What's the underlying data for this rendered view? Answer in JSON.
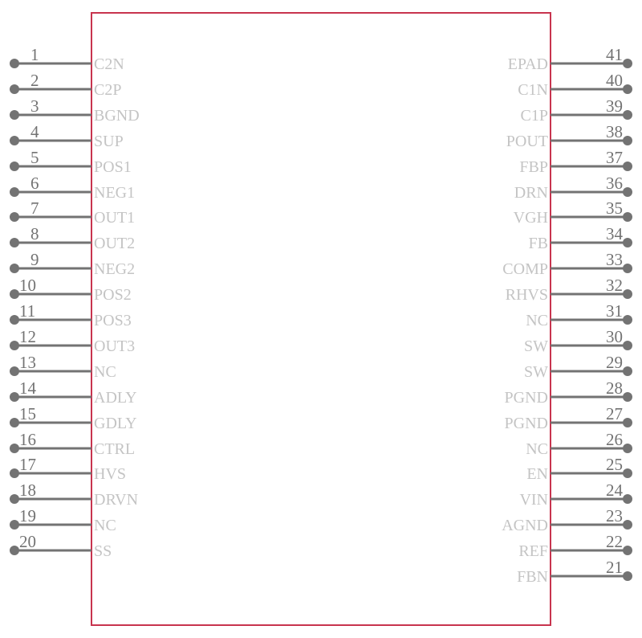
{
  "symbol": {
    "colors": {
      "body_outline": "#c8344e",
      "pin": "#737373",
      "pin_name": "#c4c4c4"
    },
    "left_pins": [
      {
        "number": "1",
        "name": "C2N"
      },
      {
        "number": "2",
        "name": "C2P"
      },
      {
        "number": "3",
        "name": "BGND"
      },
      {
        "number": "4",
        "name": "SUP"
      },
      {
        "number": "5",
        "name": "POS1"
      },
      {
        "number": "6",
        "name": "NEG1"
      },
      {
        "number": "7",
        "name": "OUT1"
      },
      {
        "number": "8",
        "name": "OUT2"
      },
      {
        "number": "9",
        "name": "NEG2"
      },
      {
        "number": "10",
        "name": "POS2"
      },
      {
        "number": "11",
        "name": "POS3"
      },
      {
        "number": "12",
        "name": "OUT3"
      },
      {
        "number": "13",
        "name": "NC"
      },
      {
        "number": "14",
        "name": "ADLY"
      },
      {
        "number": "15",
        "name": "GDLY"
      },
      {
        "number": "16",
        "name": "CTRL"
      },
      {
        "number": "17",
        "name": "HVS"
      },
      {
        "number": "18",
        "name": "DRVN"
      },
      {
        "number": "19",
        "name": "NC"
      },
      {
        "number": "20",
        "name": "SS"
      }
    ],
    "right_pins": [
      {
        "number": "41",
        "name": "EPAD"
      },
      {
        "number": "40",
        "name": "C1N"
      },
      {
        "number": "39",
        "name": "C1P"
      },
      {
        "number": "38",
        "name": "POUT"
      },
      {
        "number": "37",
        "name": "FBP"
      },
      {
        "number": "36",
        "name": "DRN"
      },
      {
        "number": "35",
        "name": "VGH"
      },
      {
        "number": "34",
        "name": "FB"
      },
      {
        "number": "33",
        "name": "COMP"
      },
      {
        "number": "32",
        "name": "RHVS"
      },
      {
        "number": "31",
        "name": "NC"
      },
      {
        "number": "30",
        "name": "SW"
      },
      {
        "number": "29",
        "name": "SW"
      },
      {
        "number": "28",
        "name": "PGND"
      },
      {
        "number": "27",
        "name": "PGND"
      },
      {
        "number": "26",
        "name": "NC"
      },
      {
        "number": "25",
        "name": "EN"
      },
      {
        "number": "24",
        "name": "VIN"
      },
      {
        "number": "23",
        "name": "AGND"
      },
      {
        "number": "22",
        "name": "REF"
      },
      {
        "number": "21",
        "name": "FBN"
      }
    ]
  }
}
